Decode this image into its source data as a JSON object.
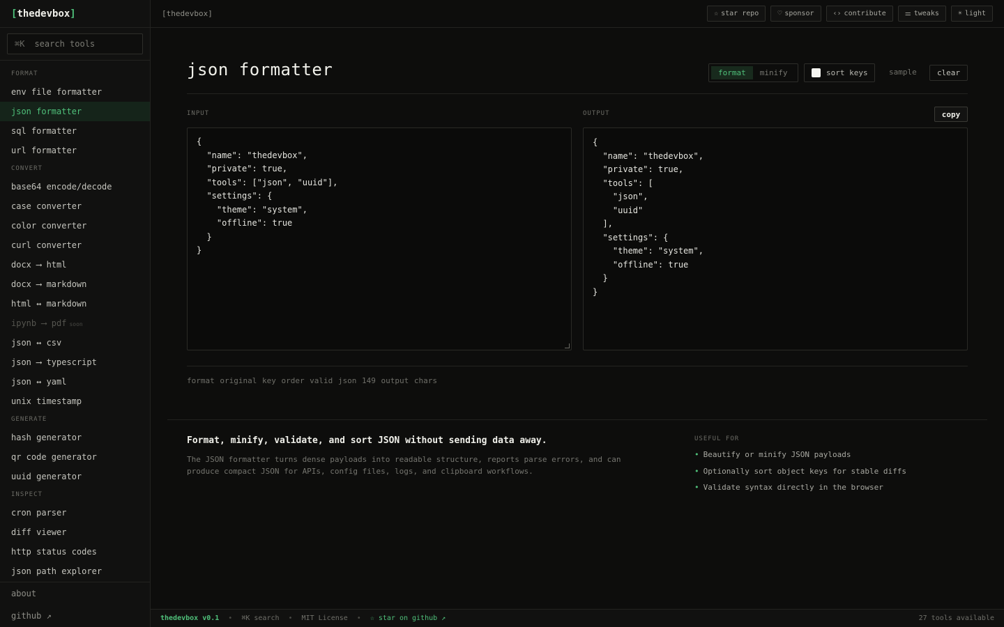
{
  "brand": {
    "open": "[",
    "name": "thedevbox",
    "close": "]"
  },
  "search": {
    "shortcut": "⌘K",
    "placeholder": "search tools"
  },
  "sidebar": {
    "groups": [
      {
        "label": "FORMAT",
        "items": [
          "env file formatter",
          "json formatter",
          "sql formatter",
          "url formatter"
        ]
      },
      {
        "label": "CONVERT",
        "items": [
          "base64 encode/decode",
          "case converter",
          "color converter",
          "curl converter",
          "docx ⟶ html",
          "docx ⟶ markdown",
          "html ↔ markdown",
          "ipynb ⟶ pdf",
          "json ↔ csv",
          "json ⟶ typescript",
          "json ↔ yaml",
          "unix timestamp"
        ]
      },
      {
        "label": "GENERATE",
        "items": [
          "hash generator",
          "qr code generator",
          "uuid generator"
        ]
      },
      {
        "label": "INSPECT",
        "items": [
          "cron parser",
          "diff viewer",
          "http status codes",
          "json path explorer"
        ]
      }
    ],
    "active_item": "json formatter",
    "soon_badge": "soon",
    "about": "about",
    "github": "github ↗"
  },
  "topbar": {
    "breadcrumb": "[thedevbox]",
    "actions": [
      {
        "icon": "star-icon",
        "glyph": "☆",
        "label": "star repo"
      },
      {
        "icon": "heart-icon",
        "glyph": "♡",
        "label": "sponsor"
      },
      {
        "icon": "code-icon",
        "glyph": "‹›",
        "label": "contribute"
      },
      {
        "icon": "sliders-icon",
        "glyph": "⚌",
        "label": "tweaks"
      },
      {
        "icon": "sun-icon",
        "glyph": "☀",
        "label": "light"
      }
    ]
  },
  "tool": {
    "title": "json formatter",
    "mode_format": "format",
    "mode_minify": "minify",
    "active_mode": "format",
    "sort_keys_label": "sort keys",
    "sort_keys_checked": false,
    "sample_label": "sample",
    "clear_label": "clear",
    "input_label": "INPUT",
    "output_label": "OUTPUT",
    "copy_label": "copy",
    "input_value": "{\n  \"name\": \"thedevbox\",\n  \"private\": true,\n  \"tools\": [\"json\", \"uuid\"],\n  \"settings\": {\n    \"theme\": \"system\",\n    \"offline\": true\n  }\n}",
    "output_value": "{\n  \"name\": \"thedevbox\",\n  \"private\": true,\n  \"tools\": [\n    \"json\",\n    \"uuid\"\n  ],\n  \"settings\": {\n    \"theme\": \"system\",\n    \"offline\": true\n  }\n}",
    "status": "format original key order valid json 149 output chars"
  },
  "about": {
    "heading": "Format, minify, validate, and sort JSON without sending data away.",
    "body": "The JSON formatter turns dense payloads into readable structure, reports parse errors, and can produce compact JSON for APIs, config files, logs, and clipboard workflows.",
    "useful_label": "USEFUL FOR",
    "useful": [
      "Beautify or minify JSON payloads",
      "Optionally sort object keys for stable diffs",
      "Validate syntax directly in the browser"
    ]
  },
  "footer": {
    "version": "thedevbox v0.1",
    "search": "⌘K search",
    "license": "MIT License",
    "star": "☆ star on github ↗",
    "tools_count": "27 tools available"
  },
  "colors": {
    "accent": "#4fc07a",
    "background": "#0d0d0c",
    "sidebar": "#111110",
    "border": "#232320"
  }
}
